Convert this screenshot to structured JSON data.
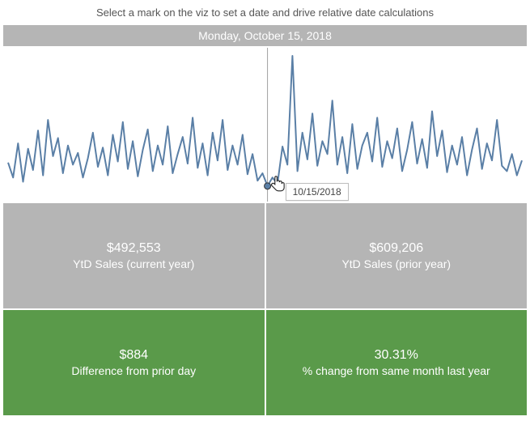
{
  "instruction": "Select a mark on the viz to set a date and drive relative date calculations",
  "selected_date_label": "Monday, October 15, 2018",
  "tooltip_text": "10/15/2018",
  "colors": {
    "line": "#5a7fa6",
    "marker_line": "#a0a0a0",
    "kpi_gray": "#b5b5b5",
    "kpi_green": "#5a9a4a"
  },
  "kpis": [
    {
      "value": "$492,553",
      "label": "YtD Sales (current year)",
      "style": "gray"
    },
    {
      "value": "$609,206",
      "label": "YtD Sales (prior year)",
      "style": "gray"
    },
    {
      "value": "$884",
      "label": "Difference from prior day",
      "style": "green"
    },
    {
      "value": "30.31%",
      "label": "% change from same month last year",
      "style": "green"
    }
  ],
  "chart_data": {
    "type": "line",
    "title": "",
    "xlabel": "",
    "ylabel": "",
    "ylim": [
      0,
      135
    ],
    "selected_index": 52,
    "x_is_date_sequence": true,
    "values": [
      32,
      18,
      50,
      14,
      45,
      25,
      62,
      20,
      72,
      38,
      55,
      22,
      48,
      30,
      41,
      18,
      36,
      60,
      28,
      46,
      20,
      58,
      33,
      70,
      26,
      52,
      19,
      44,
      63,
      24,
      48,
      30,
      66,
      22,
      40,
      56,
      31,
      74,
      27,
      50,
      20,
      60,
      34,
      72,
      25,
      48,
      30,
      58,
      21,
      40,
      15,
      22,
      10,
      18,
      12,
      47,
      30,
      132,
      24,
      60,
      35,
      78,
      29,
      52,
      40,
      90,
      30,
      56,
      22,
      68,
      26,
      48,
      60,
      33,
      74,
      28,
      52,
      36,
      64,
      24,
      44,
      70,
      31,
      54,
      27,
      80,
      38,
      62,
      23,
      48,
      30,
      56,
      20,
      44,
      64,
      26,
      50,
      34,
      72,
      29,
      24,
      40,
      20,
      34
    ]
  }
}
